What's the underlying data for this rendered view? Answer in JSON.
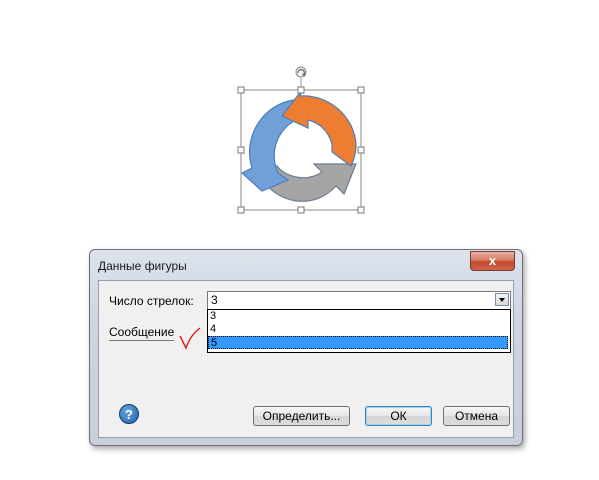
{
  "dialog": {
    "title": "Данные фигуры",
    "close_label": "x",
    "arrow_count_label": "Число стрелок:",
    "arrow_count_value": "3",
    "arrow_count_options": [
      "3",
      "4",
      "5"
    ],
    "highlighted_option": "5",
    "message_label": "Сообщение",
    "help_label": "?",
    "define_button": "Определить...",
    "ok_button": "ОК",
    "cancel_button": "Отмена"
  },
  "shape": {
    "type": "circular-arrows",
    "arrow_count": 3,
    "colors": {
      "orange": "#ed7d31",
      "blue": "#6fa0d8",
      "gray": "#a5a5a5"
    }
  }
}
